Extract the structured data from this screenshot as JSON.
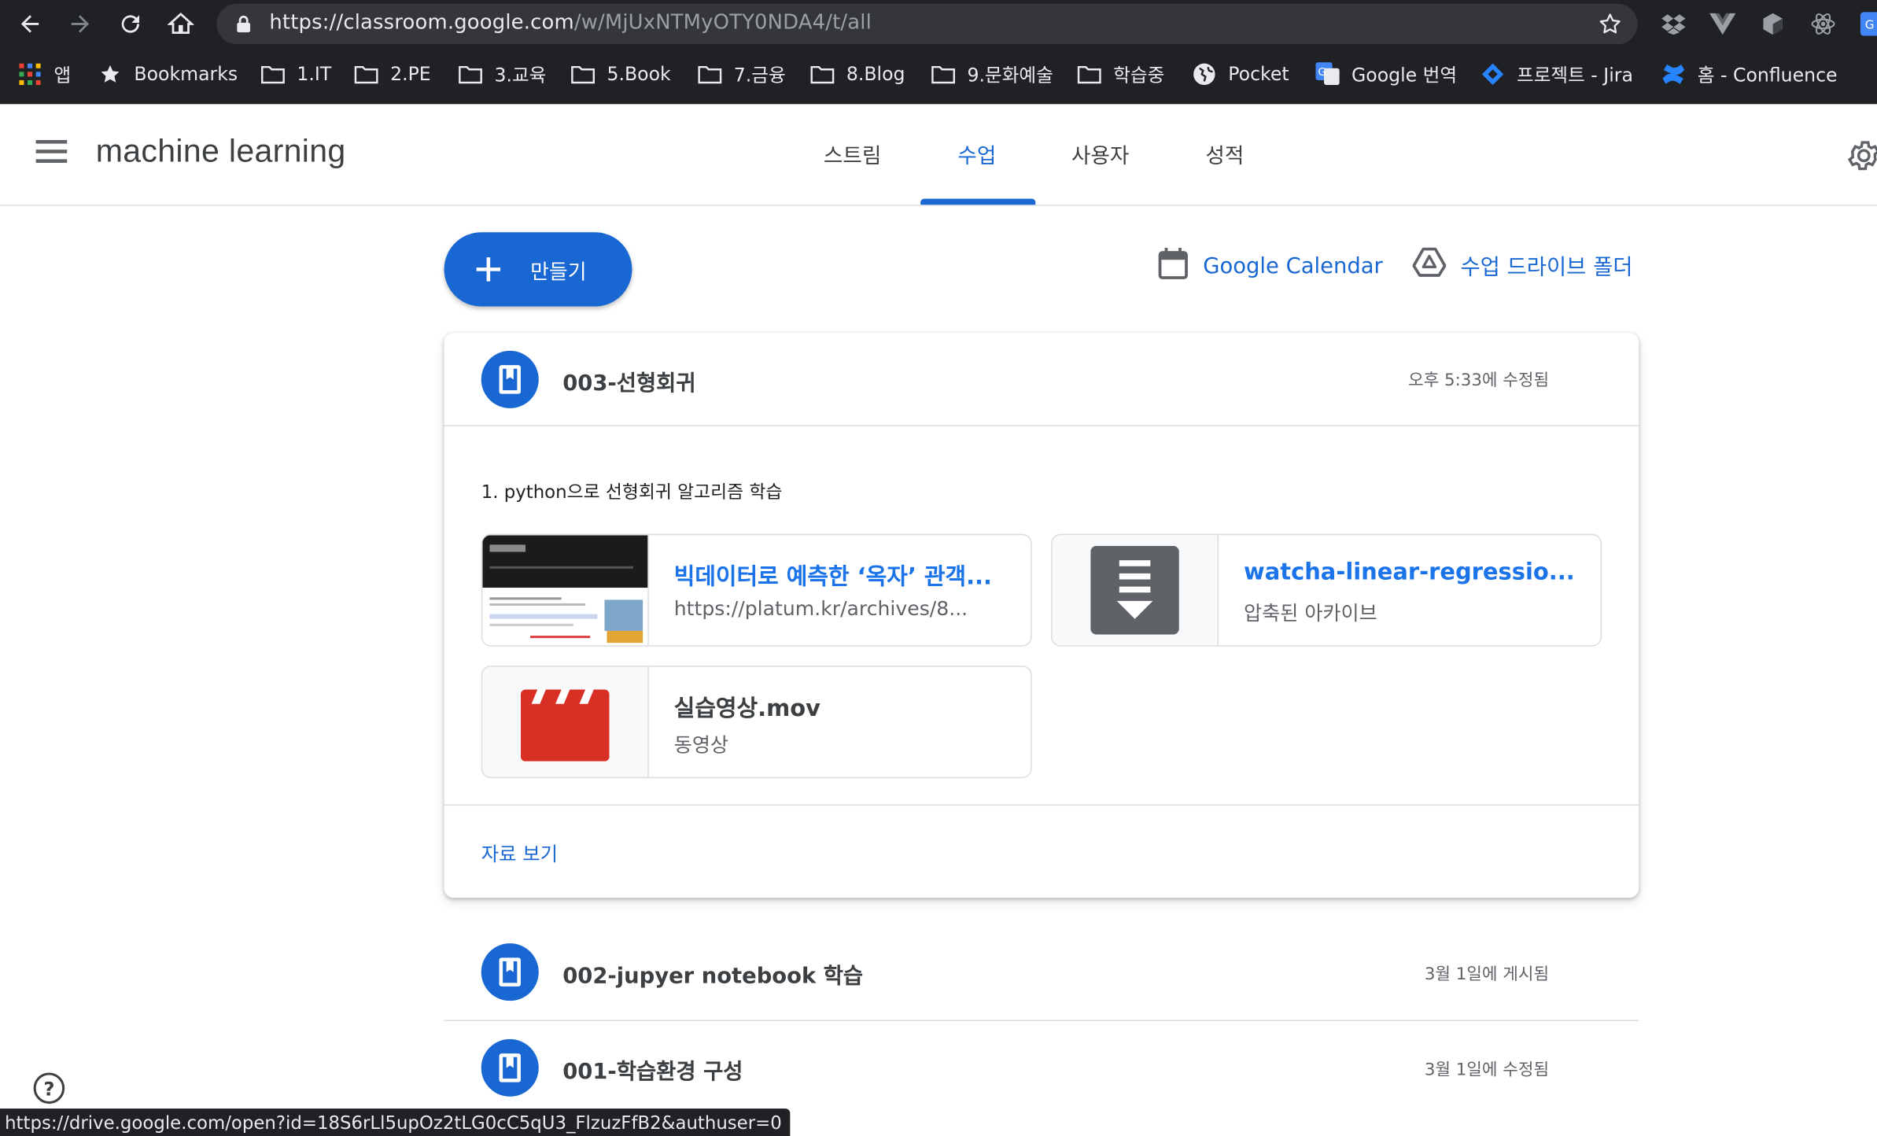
{
  "browser": {
    "url_main": "https://classroom.google.com",
    "url_path": "/w/MjUxNTMyOTY0NDA4/t/all",
    "bookmarks": [
      {
        "label": "앱",
        "icon": "apps-grid-icon"
      },
      {
        "label": "Bookmarks",
        "icon": "star-icon"
      },
      {
        "label": "1.IT",
        "icon": "folder-icon"
      },
      {
        "label": "2.PE",
        "icon": "folder-icon"
      },
      {
        "label": "3.교육",
        "icon": "folder-icon"
      },
      {
        "label": "5.Book",
        "icon": "folder-icon"
      },
      {
        "label": "7.금융",
        "icon": "folder-icon"
      },
      {
        "label": "8.Blog",
        "icon": "folder-icon"
      },
      {
        "label": "9.문화예술",
        "icon": "folder-icon"
      },
      {
        "label": "학습중",
        "icon": "folder-icon"
      },
      {
        "label": "Pocket",
        "icon": "globe-icon"
      },
      {
        "label": "Google 번역",
        "icon": "google-translate-icon"
      },
      {
        "label": "프로젝트 - Jira",
        "icon": "jira-icon"
      },
      {
        "label": "홈 - Confluence",
        "icon": "confluence-icon"
      }
    ],
    "status_url": "https://drive.google.com/open?id=18S6rLl5upOz2tLG0cC5qU3_FlzuzFfB2&authuser=0"
  },
  "header": {
    "class_title": "machine learning",
    "tabs": [
      {
        "label": "스트림",
        "active": false
      },
      {
        "label": "수업",
        "active": true
      },
      {
        "label": "사용자",
        "active": false
      },
      {
        "label": "성적",
        "active": false
      }
    ]
  },
  "actions": {
    "create_label": "만들기",
    "calendar_label": "Google Calendar",
    "drive_label": "수업 드라이브 폴더"
  },
  "topics": [
    {
      "title": "003-선형회귀",
      "meta": "오후 5:33에 수정됨",
      "description": "1. python으로 선형회귀 알고리즘 학습",
      "attachments": [
        {
          "title": "빅데이터로 예측한 ‘옥자’ 관객...",
          "subtitle": "https://platum.kr/archives/8...",
          "kind": "link"
        },
        {
          "title": "watcha-linear-regressio...",
          "subtitle": "압축된 아카이브",
          "kind": "archive"
        },
        {
          "title": "실습영상.mov",
          "subtitle": "동영상",
          "kind": "video"
        }
      ],
      "view_more": "자료 보기"
    },
    {
      "title": "002-jupyer notebook 학습",
      "meta": "3월 1일에 게시됨"
    },
    {
      "title": "001-학습환경 구성",
      "meta": "3월 1일에 수정됨"
    }
  ],
  "help": "?",
  "colors": {
    "accent": "#1967d2",
    "chrome_bg": "#202124",
    "video_red": "#d93025",
    "archive_gray": "#5f6368"
  }
}
